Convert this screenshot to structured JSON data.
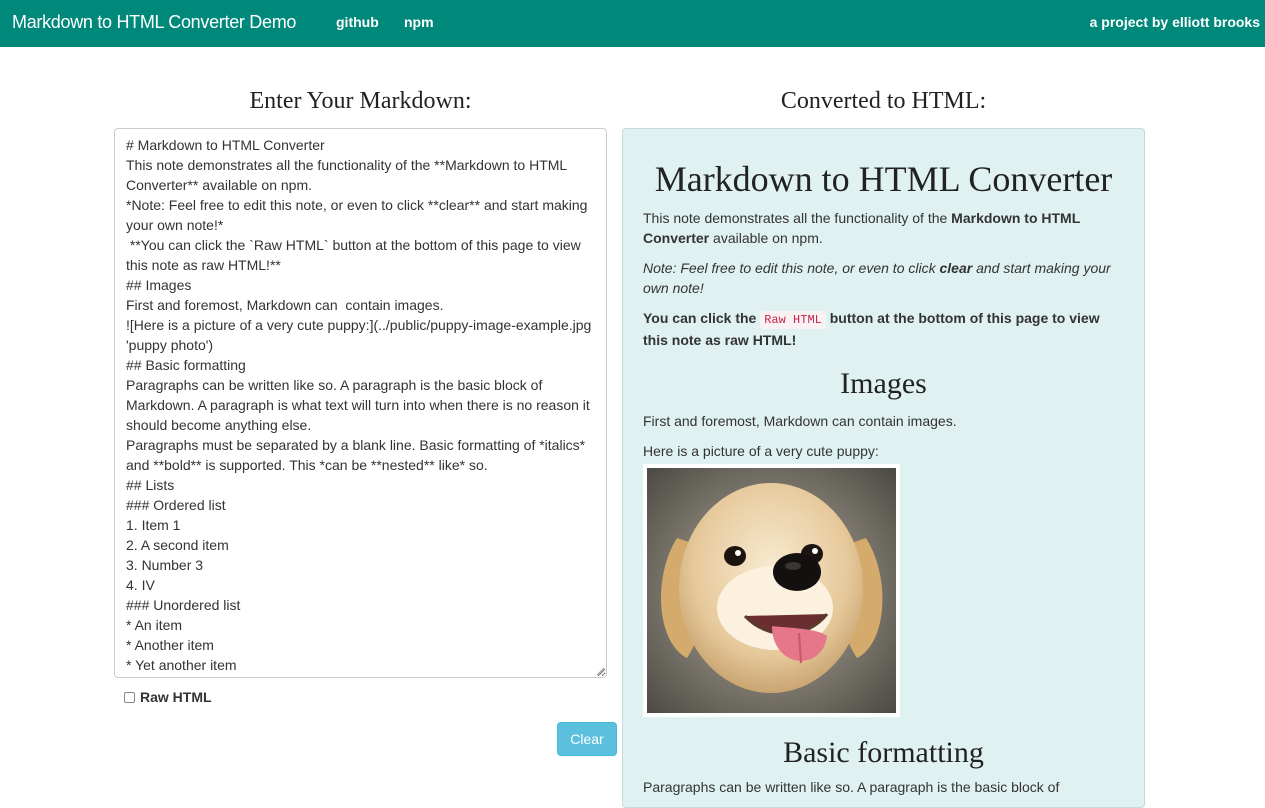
{
  "navbar": {
    "brand": "Markdown to HTML Converter Demo",
    "links": [
      "github",
      "npm"
    ],
    "right_text": "a project by elliott brooks",
    "color": "#00897b"
  },
  "left": {
    "heading": "Enter Your Markdown:",
    "markdown_lines": [
      "# Markdown to HTML Converter",
      "This note demonstrates all the functionality of the **Markdown to HTML Converter** available on npm.",
      "*Note: Feel free to edit this note, or even to click **clear** and start making your own note!*",
      " **You can click the `Raw HTML` button at the bottom of this page to view this note as raw HTML!**",
      "## Images",
      "First and foremost, Markdown can  contain images.",
      "![Here is a picture of a very cute puppy:](../public/puppy-image-example.jpg 'puppy photo')",
      "## Basic formatting",
      "Paragraphs can be written like so. A paragraph is the basic block of Markdown. A paragraph is what text will turn into when there is no reason it should become anything else.",
      "Paragraphs must be separated by a blank line. Basic formatting of *italics* and **bold** is supported. This *can be **nested** like* so.",
      "## Lists",
      "### Ordered list",
      "1. Item 1",
      "2. A second item",
      "3. Number 3",
      "4. IV",
      "### Unordered list",
      "* An item",
      "* Another item",
      "* Yet another item"
    ],
    "raw_html_label": "Raw HTML",
    "raw_html_checked": false,
    "clear_label": "Clear",
    "clear_color": "#5bc0de"
  },
  "right": {
    "heading": "Converted to HTML:",
    "h1": "Markdown to HTML Converter",
    "p1_before": "This note demonstrates all the functionality of the ",
    "p1_bold": "Markdown to HTML Converter",
    "p1_after": " available on npm.",
    "p2_before": "Note: Feel free to edit this note, or even to click ",
    "p2_bold": "clear",
    "p2_after": " and start making your own note!",
    "p3_before": "You can click the ",
    "p3_code": "Raw HTML",
    "p3_after": " button at the bottom of this page to view this note as raw HTML!",
    "h2_images": "Images",
    "p4": "First and foremost, Markdown can contain images.",
    "p5": "Here is a picture of a very cute puppy:",
    "h2_basic": "Basic formatting",
    "p6": "Paragraphs can be written like so. A paragraph is the basic block of",
    "background": "#e0f1f1"
  }
}
